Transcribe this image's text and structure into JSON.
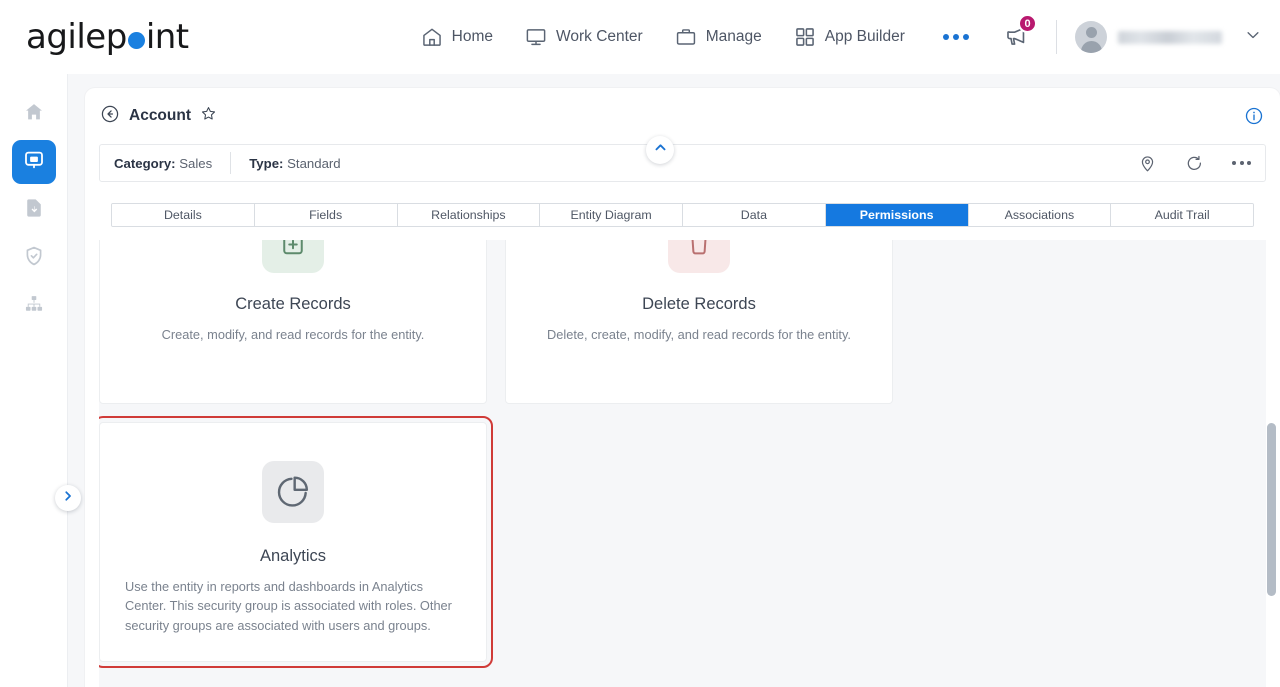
{
  "brand": {
    "name_part1": "agilep",
    "name_part2": "int",
    "dot_color": "#1a80e0"
  },
  "header": {
    "nav": [
      {
        "label": "Home",
        "icon": "home-icon"
      },
      {
        "label": "Work Center",
        "icon": "monitor-icon"
      },
      {
        "label": "Manage",
        "icon": "briefcase-icon"
      },
      {
        "label": "App Builder",
        "icon": "grid-icon"
      }
    ],
    "more_label": "",
    "notification_count": "0",
    "username": "",
    "accent_color": "#1a80e0",
    "badge_color": "#b9196f"
  },
  "rail": {
    "items": [
      {
        "name": "home",
        "active": false
      },
      {
        "name": "app-builder",
        "active": true
      },
      {
        "name": "documents",
        "active": false
      },
      {
        "name": "security",
        "active": false
      },
      {
        "name": "org-chart",
        "active": false
      }
    ]
  },
  "breadcrumb": {
    "title": "Account"
  },
  "meta": {
    "category_label": "Category:",
    "category_value": "Sales",
    "type_label": "Type:",
    "type_value": "Standard"
  },
  "tabs": [
    {
      "label": "Details",
      "active": false
    },
    {
      "label": "Fields",
      "active": false
    },
    {
      "label": "Relationships",
      "active": false
    },
    {
      "label": "Entity Diagram",
      "active": false
    },
    {
      "label": "Data",
      "active": false
    },
    {
      "label": "Permissions",
      "active": true
    },
    {
      "label": "Associations",
      "active": false
    },
    {
      "label": "Audit Trail",
      "active": false
    }
  ],
  "permission_cards": [
    {
      "title": "Create Records",
      "description": "Create, modify, and read records for the entity.",
      "icon_bg": "#e4efe7",
      "highlighted": false
    },
    {
      "title": "Delete Records",
      "description": "Delete, create, modify, and read records for the entity.",
      "icon_bg": "#f8e8e8",
      "highlighted": false
    },
    {
      "title": "Analytics",
      "description": "Use the entity in reports and dashboards in Analytics Center. This security group is associated with roles. Other security groups are associated with users and groups.",
      "icon_bg": "#e9eaec",
      "highlighted": true,
      "highlight_color": "#d03b38"
    }
  ]
}
